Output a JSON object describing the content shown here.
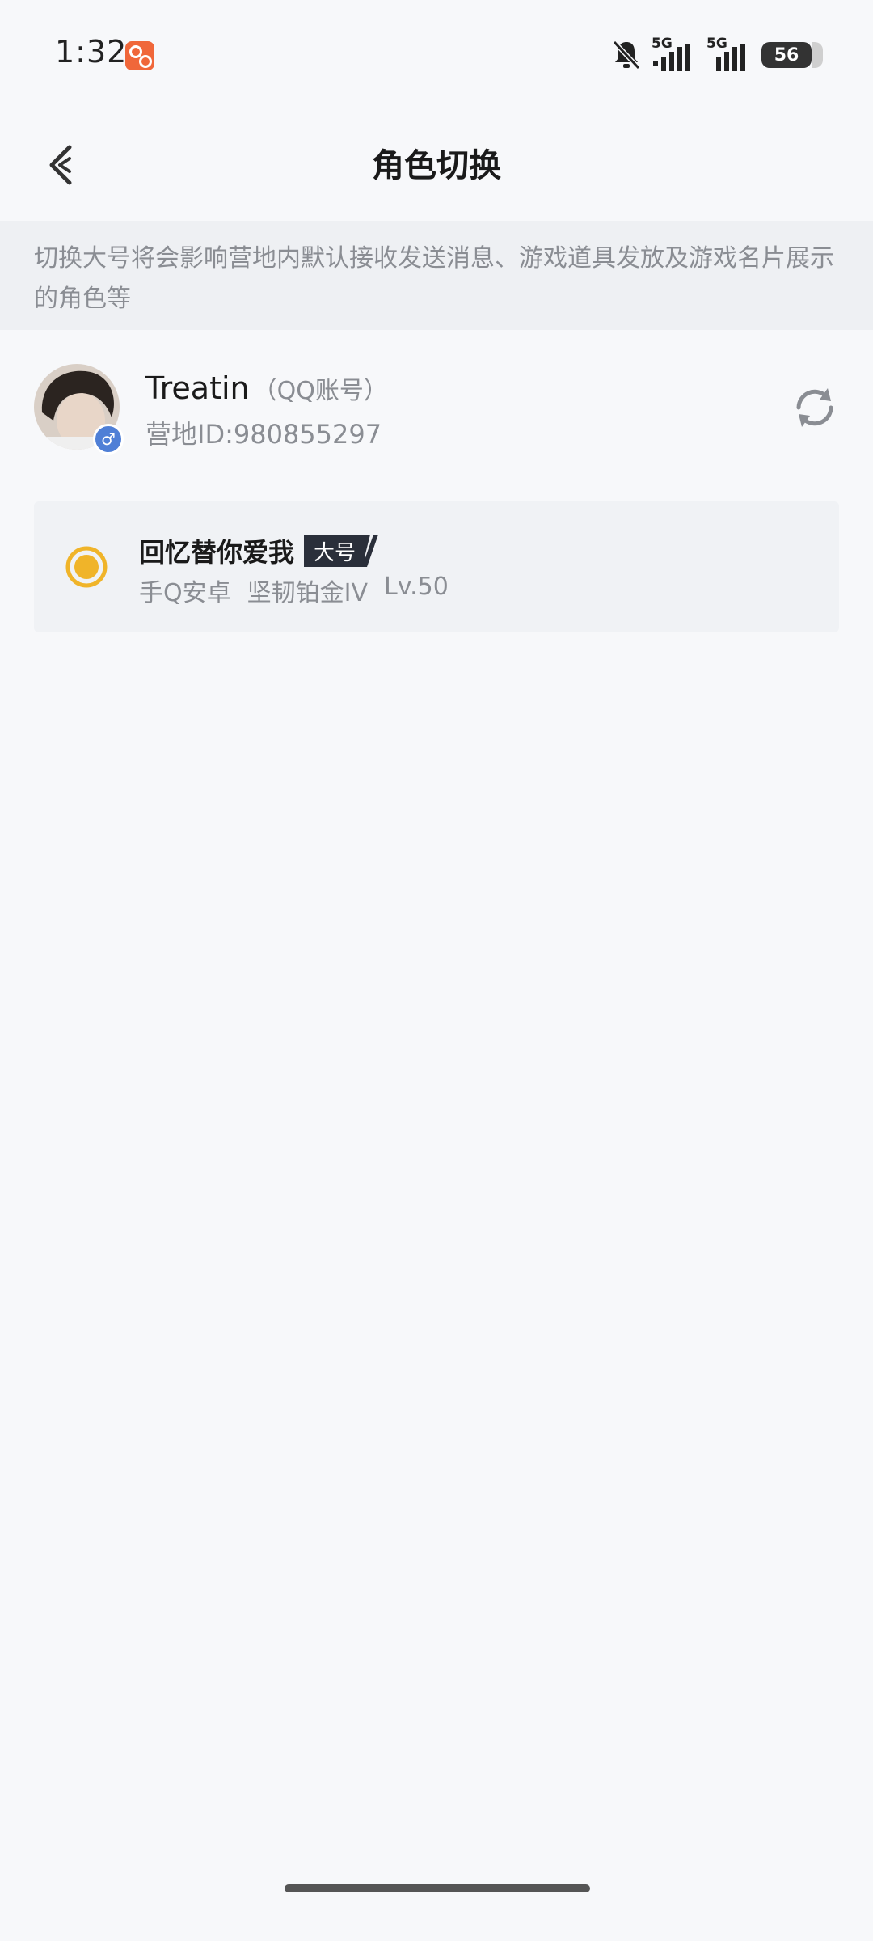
{
  "status_bar": {
    "time": "1:32",
    "sim1_network": "5G",
    "sim2_network": "5G",
    "battery": "56"
  },
  "header": {
    "title": "角色切换"
  },
  "notice": {
    "text": "切换大号将会影响营地内默认接收发送消息、游戏道具发放及游戏名片展示的角色等"
  },
  "account": {
    "name": "Treatin",
    "type": "（QQ账号）",
    "camp_id": "营地ID:980855297",
    "gender_symbol": "♂"
  },
  "role": {
    "name": "回忆替你爱我",
    "badge": "大号",
    "platform": "手Q安卓",
    "rank": "坚韧铂金IV",
    "level": "Lv.50",
    "selected": true,
    "accent_color": "#f0b429"
  }
}
